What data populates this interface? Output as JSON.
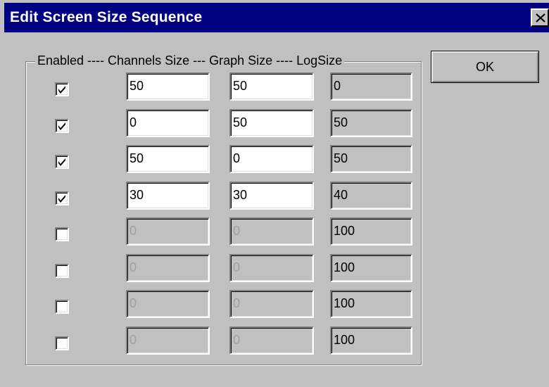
{
  "window": {
    "title": "Edit Screen Size Sequence"
  },
  "group": {
    "legend": "Enabled ---- Channels Size --- Graph Size ---- LogSize"
  },
  "buttons": {
    "ok_label": "OK"
  },
  "rows": [
    {
      "enabled": true,
      "channels": "50",
      "graph": "50",
      "log": "0"
    },
    {
      "enabled": true,
      "channels": "0",
      "graph": "50",
      "log": "50"
    },
    {
      "enabled": true,
      "channels": "50",
      "graph": "0",
      "log": "50"
    },
    {
      "enabled": true,
      "channels": "30",
      "graph": "30",
      "log": "40"
    },
    {
      "enabled": false,
      "channels": "0",
      "graph": "0",
      "log": "100"
    },
    {
      "enabled": false,
      "channels": "0",
      "graph": "0",
      "log": "100"
    },
    {
      "enabled": false,
      "channels": "0",
      "graph": "0",
      "log": "100"
    },
    {
      "enabled": false,
      "channels": "0",
      "graph": "0",
      "log": "100"
    }
  ],
  "colors": {
    "title_bar": "#000080",
    "dialog_face": "#c0c0c0",
    "field_enabled": "#ffffff",
    "disabled_text": "#a0a0a0"
  },
  "icons": {
    "close": "close-icon",
    "check": "checkmark-icon"
  }
}
